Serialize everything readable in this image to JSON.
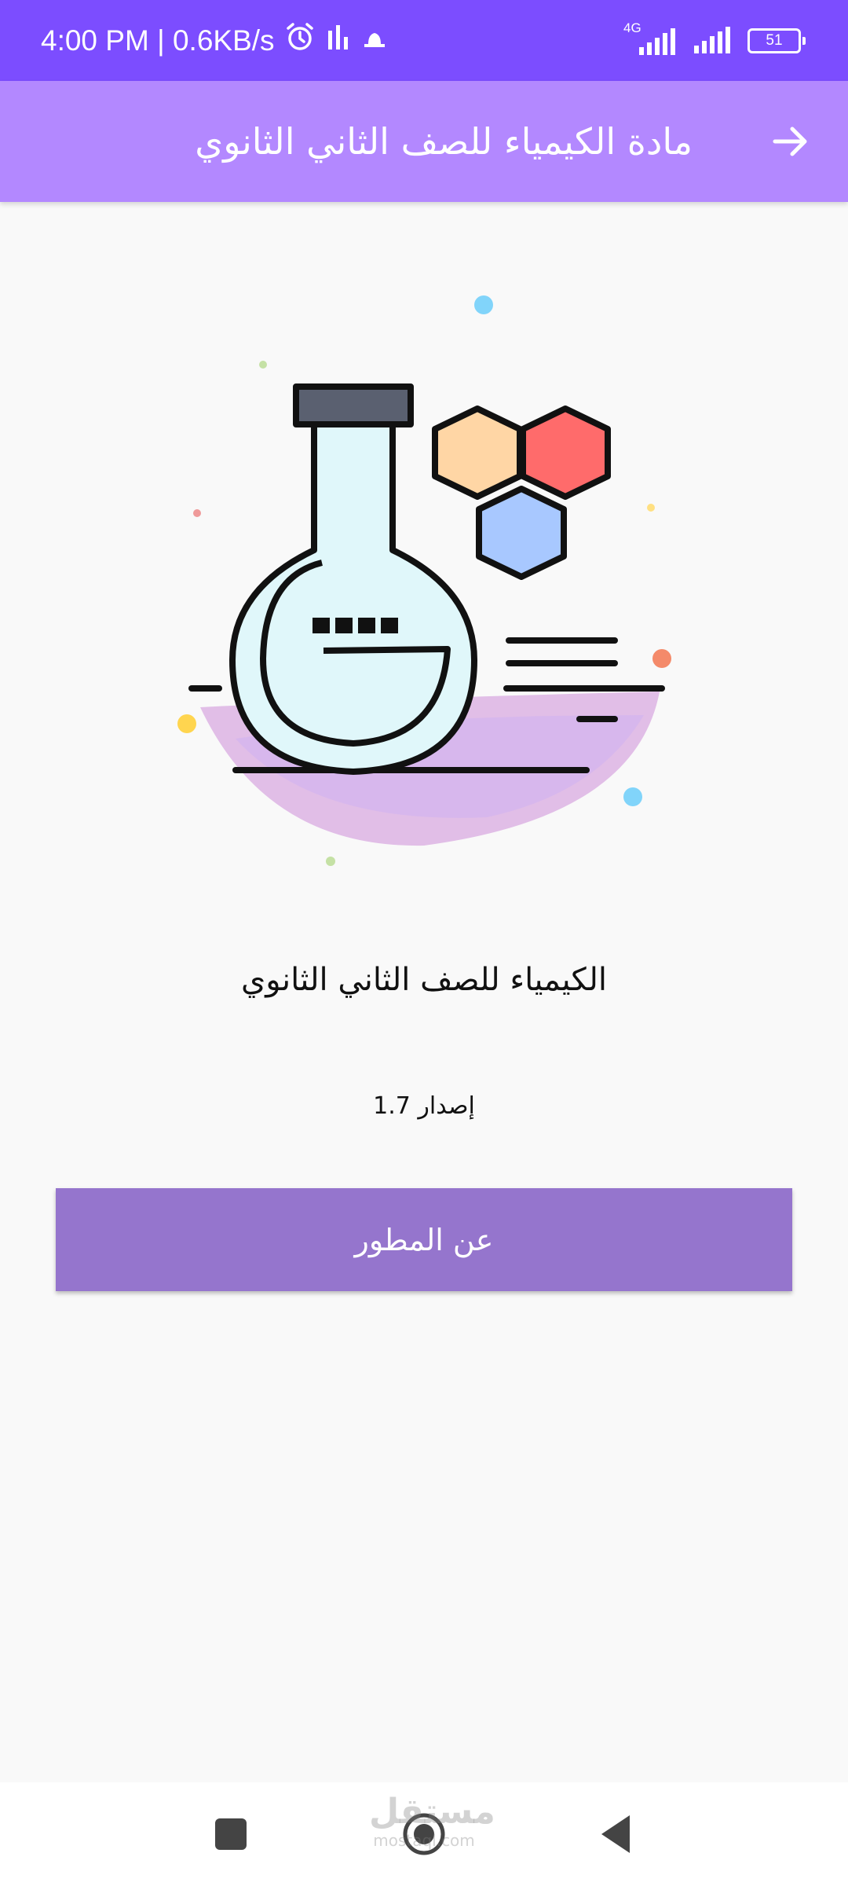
{
  "status_bar": {
    "time_speed": "4:00 PM | 0.6KB/s",
    "network_label": "4G",
    "battery_level": "51"
  },
  "app_bar": {
    "title": "مادة الكيمياء للصف الثاني الثانوي",
    "back_icon": "arrow-right-icon"
  },
  "content": {
    "app_name": "الكيمياء للصف الثاني الثانوي",
    "version_label": "إصدار 1.7",
    "about_button_label": "عن المطور"
  },
  "watermark": {
    "text": "مستقل",
    "sub": "mostaql.com"
  },
  "colors": {
    "status_bar": "#7c4dff",
    "app_bar": "#b388ff",
    "button": "#9575cd",
    "background": "#f9f9f9"
  }
}
